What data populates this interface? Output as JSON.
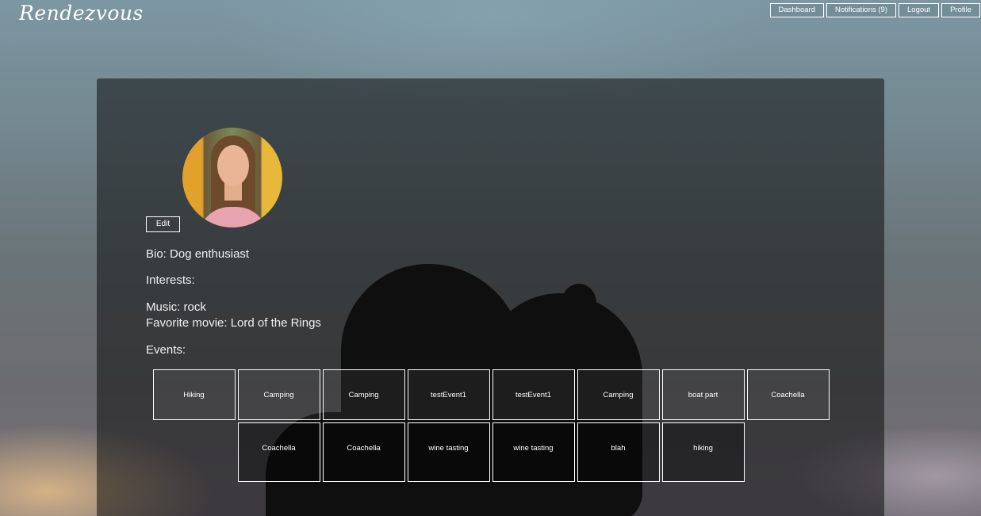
{
  "brand": "Rendezvous",
  "nav": {
    "dashboard": "Dashboard",
    "notifications": "Notifications (9)",
    "logout": "Logout",
    "profile": "Profile"
  },
  "profile": {
    "edit_label": "Edit",
    "bio": "Bio: Dog enthusiast",
    "interests_label": "Interests:",
    "music": "Music: rock",
    "movie": "Favorite movie: Lord of the Rings",
    "events_label": "Events:"
  },
  "events": [
    "Hiking",
    "Camping",
    "Camping",
    "testEvent1",
    "testEvent1",
    "Camping",
    "boat part",
    "Coachella",
    "Coachella",
    "Coachella",
    "wine tasting",
    "wine tasting",
    "blah",
    "hiking"
  ]
}
